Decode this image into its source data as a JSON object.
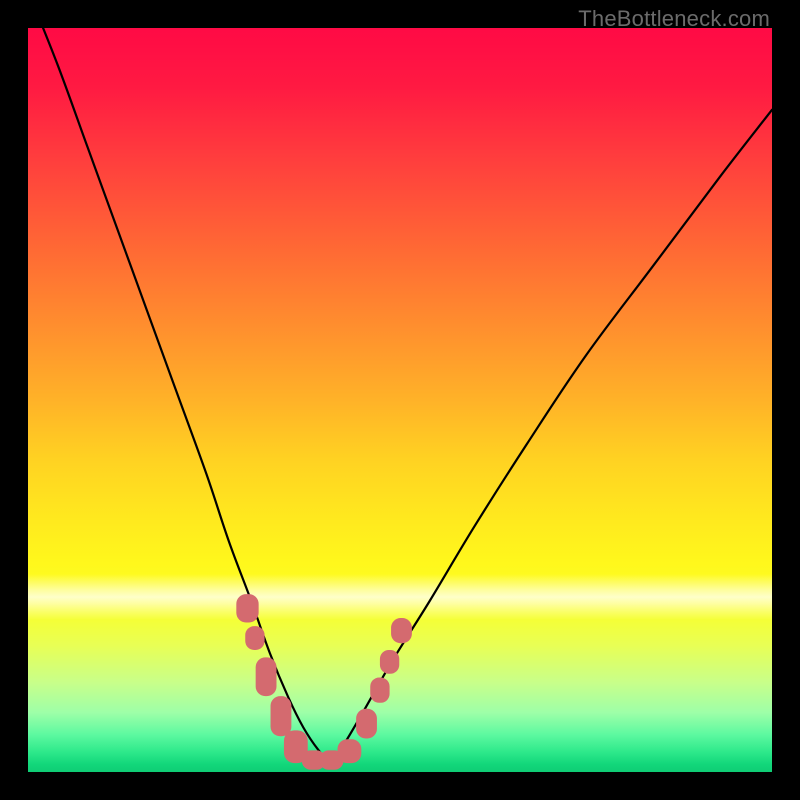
{
  "watermark": "TheBottleneck.com",
  "chart_data": {
    "type": "line",
    "title": "",
    "xlabel": "",
    "ylabel": "",
    "xlim": [
      0,
      100
    ],
    "ylim": [
      0,
      100
    ],
    "series": [
      {
        "name": "bottleneck-curve",
        "x": [
          0,
          4,
          8,
          12,
          16,
          20,
          24,
          27,
          30,
          32.5,
          35,
          37,
          39,
          40.5,
          42,
          45,
          49,
          54,
          60,
          67,
          75,
          84,
          93,
          100
        ],
        "y": [
          105,
          95,
          84,
          73,
          62,
          51,
          40,
          31,
          23,
          16,
          10,
          6,
          3,
          1.5,
          3,
          8,
          15,
          23,
          33,
          44,
          56,
          68,
          80,
          89
        ]
      }
    ],
    "markers": {
      "name": "optimal-range",
      "shape": "rounded-rect",
      "color": "#d46a6f",
      "points": [
        {
          "x": 29.5,
          "y": 22.0,
          "w": 3.0,
          "h": 3.8,
          "r": 1.3
        },
        {
          "x": 30.5,
          "y": 18.0,
          "w": 2.6,
          "h": 3.2,
          "r": 1.2
        },
        {
          "x": 32.0,
          "y": 12.8,
          "w": 2.8,
          "h": 5.2,
          "r": 1.3
        },
        {
          "x": 34.0,
          "y": 7.5,
          "w": 2.8,
          "h": 5.4,
          "r": 1.3
        },
        {
          "x": 36.0,
          "y": 3.4,
          "w": 3.2,
          "h": 4.4,
          "r": 1.4
        },
        {
          "x": 38.4,
          "y": 1.6,
          "w": 3.2,
          "h": 2.6,
          "r": 1.2
        },
        {
          "x": 40.8,
          "y": 1.6,
          "w": 3.2,
          "h": 2.6,
          "r": 1.2
        },
        {
          "x": 43.2,
          "y": 2.8,
          "w": 3.2,
          "h": 3.2,
          "r": 1.3
        },
        {
          "x": 45.5,
          "y": 6.5,
          "w": 2.8,
          "h": 4.0,
          "r": 1.3
        },
        {
          "x": 47.3,
          "y": 11.0,
          "w": 2.6,
          "h": 3.4,
          "r": 1.2
        },
        {
          "x": 48.6,
          "y": 14.8,
          "w": 2.6,
          "h": 3.2,
          "r": 1.2
        },
        {
          "x": 50.2,
          "y": 19.0,
          "w": 2.8,
          "h": 3.4,
          "r": 1.3
        }
      ]
    },
    "gradient_stops": [
      {
        "pos": 0.0,
        "color": "#ff0a45"
      },
      {
        "pos": 0.5,
        "color": "#ffb228"
      },
      {
        "pos": 0.75,
        "color": "#fff81c"
      },
      {
        "pos": 1.0,
        "color": "#0fcd75"
      }
    ]
  }
}
